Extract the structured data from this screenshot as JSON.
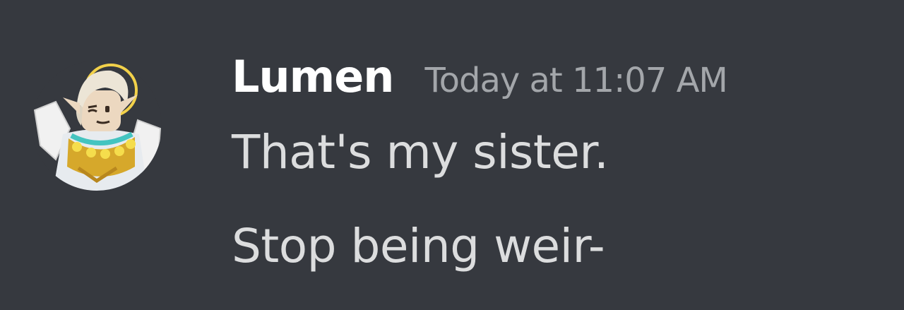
{
  "theme": {
    "background": "#36393f",
    "username_color": "#ffffff",
    "timestamp_color": "#a3a6aa",
    "message_color": "#dcddde"
  },
  "message": {
    "avatar": {
      "icon": "avatar-knight-icon",
      "accent": "#e8c233"
    },
    "author": "Lumen",
    "timestamp": "Today at 11:07 AM",
    "lines": [
      "That's my sister.",
      "Stop being weir-"
    ]
  }
}
